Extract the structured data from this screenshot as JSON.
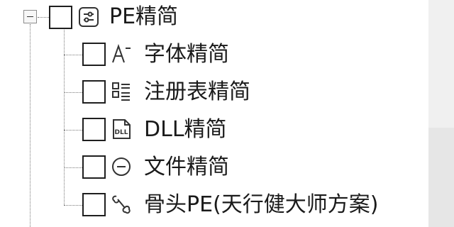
{
  "tree": {
    "root": {
      "label": "PE精简",
      "icon": "settings-sliders-icon",
      "expanded": true,
      "checked": false
    },
    "children": [
      {
        "label": "字体精简",
        "icon": "font-icon",
        "checked": false
      },
      {
        "label": "注册表精简",
        "icon": "registry-list-icon",
        "checked": false
      },
      {
        "label": "DLL精简",
        "icon": "dll-file-icon",
        "checked": false
      },
      {
        "label": "文件精简",
        "icon": "minus-circle-icon",
        "checked": false
      },
      {
        "label": "骨头PE(天行健大师方案)",
        "icon": "bone-icon",
        "checked": false
      }
    ]
  },
  "colors": {
    "text": "#1a1a1a",
    "checkbox_border": "#1f1f1f",
    "tree_lines": "#7a7a7a",
    "scrollbar_track": "#e6e6e6"
  }
}
